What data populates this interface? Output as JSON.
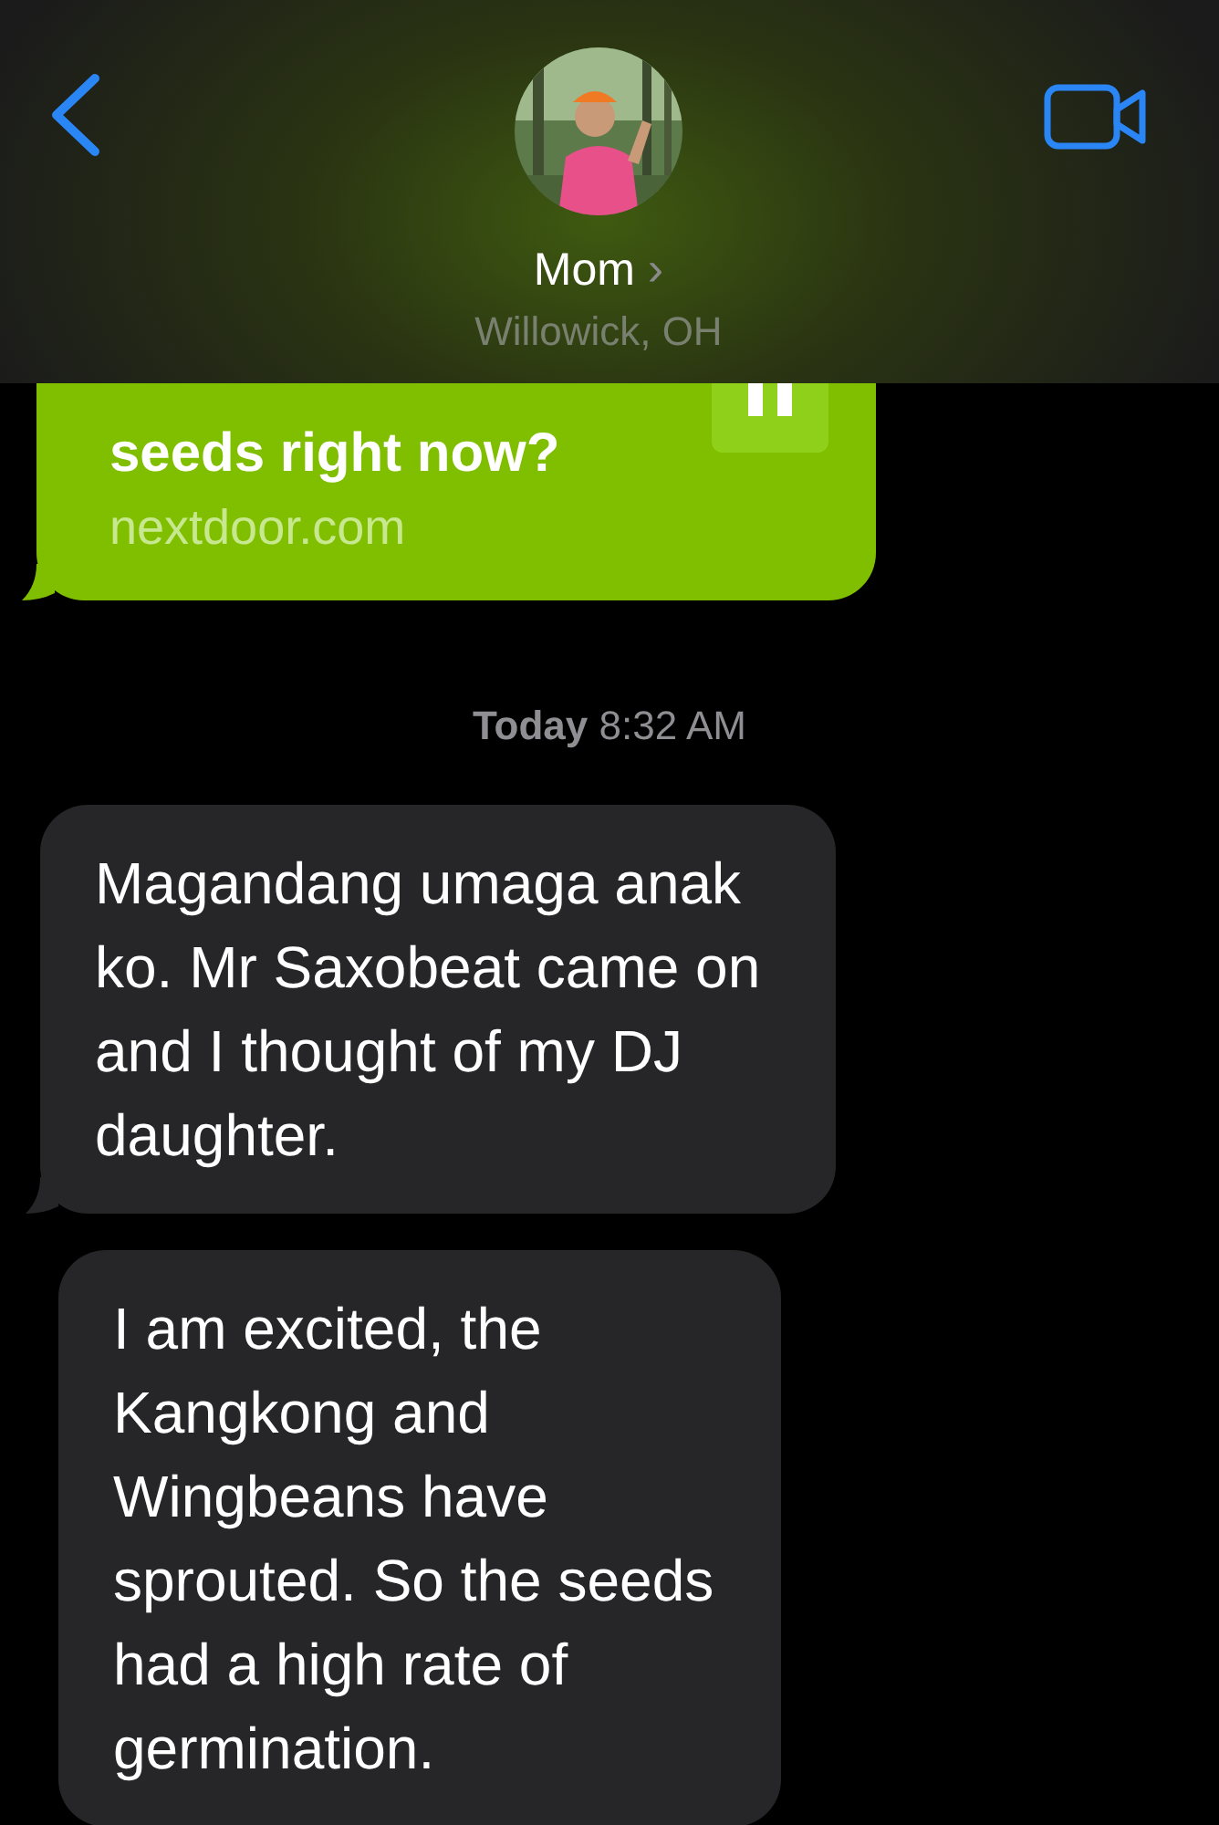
{
  "header": {
    "contact_name": "Mom",
    "chevron": "›",
    "location": "Willowick, OH"
  },
  "messages": [
    {
      "kind": "link",
      "text": "seeds right now?",
      "domain": "nextdoor.com"
    },
    {
      "kind": "timestamp",
      "day": "Today",
      "time": "8:32 AM"
    },
    {
      "kind": "incoming",
      "text": "Magandang umaga anak ko. Mr Saxobeat came on and I thought of my DJ daughter.",
      "tail": true
    },
    {
      "kind": "incoming",
      "text": "I am excited, the Kangkong and Wingbeans have sprouted. So the seeds had a high rate of germination.",
      "tail": false
    }
  ]
}
